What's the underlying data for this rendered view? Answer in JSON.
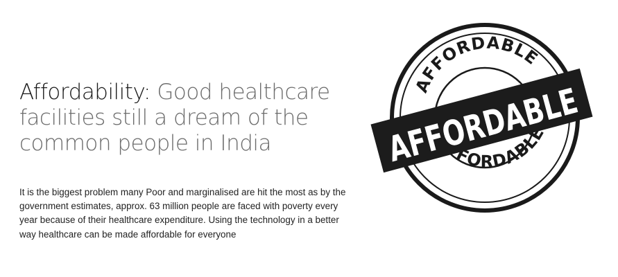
{
  "heading": {
    "lead": "Affordability:",
    "rest": " Good healthcare facilities still a dream of the common people in India"
  },
  "body": {
    "paragraph": "It is the biggest problem many Poor and marginalised are hit the most as by the government estimates, approx. 63 million people are faced with poverty every year because of their healthcare expenditure. Using the technology in a better way healthcare can be made affordable for everyone"
  },
  "stamp": {
    "top_arc": "AFFORDABLE",
    "bottom_arc": "AFFORDABLE",
    "banner": "AFFORDABLE"
  }
}
